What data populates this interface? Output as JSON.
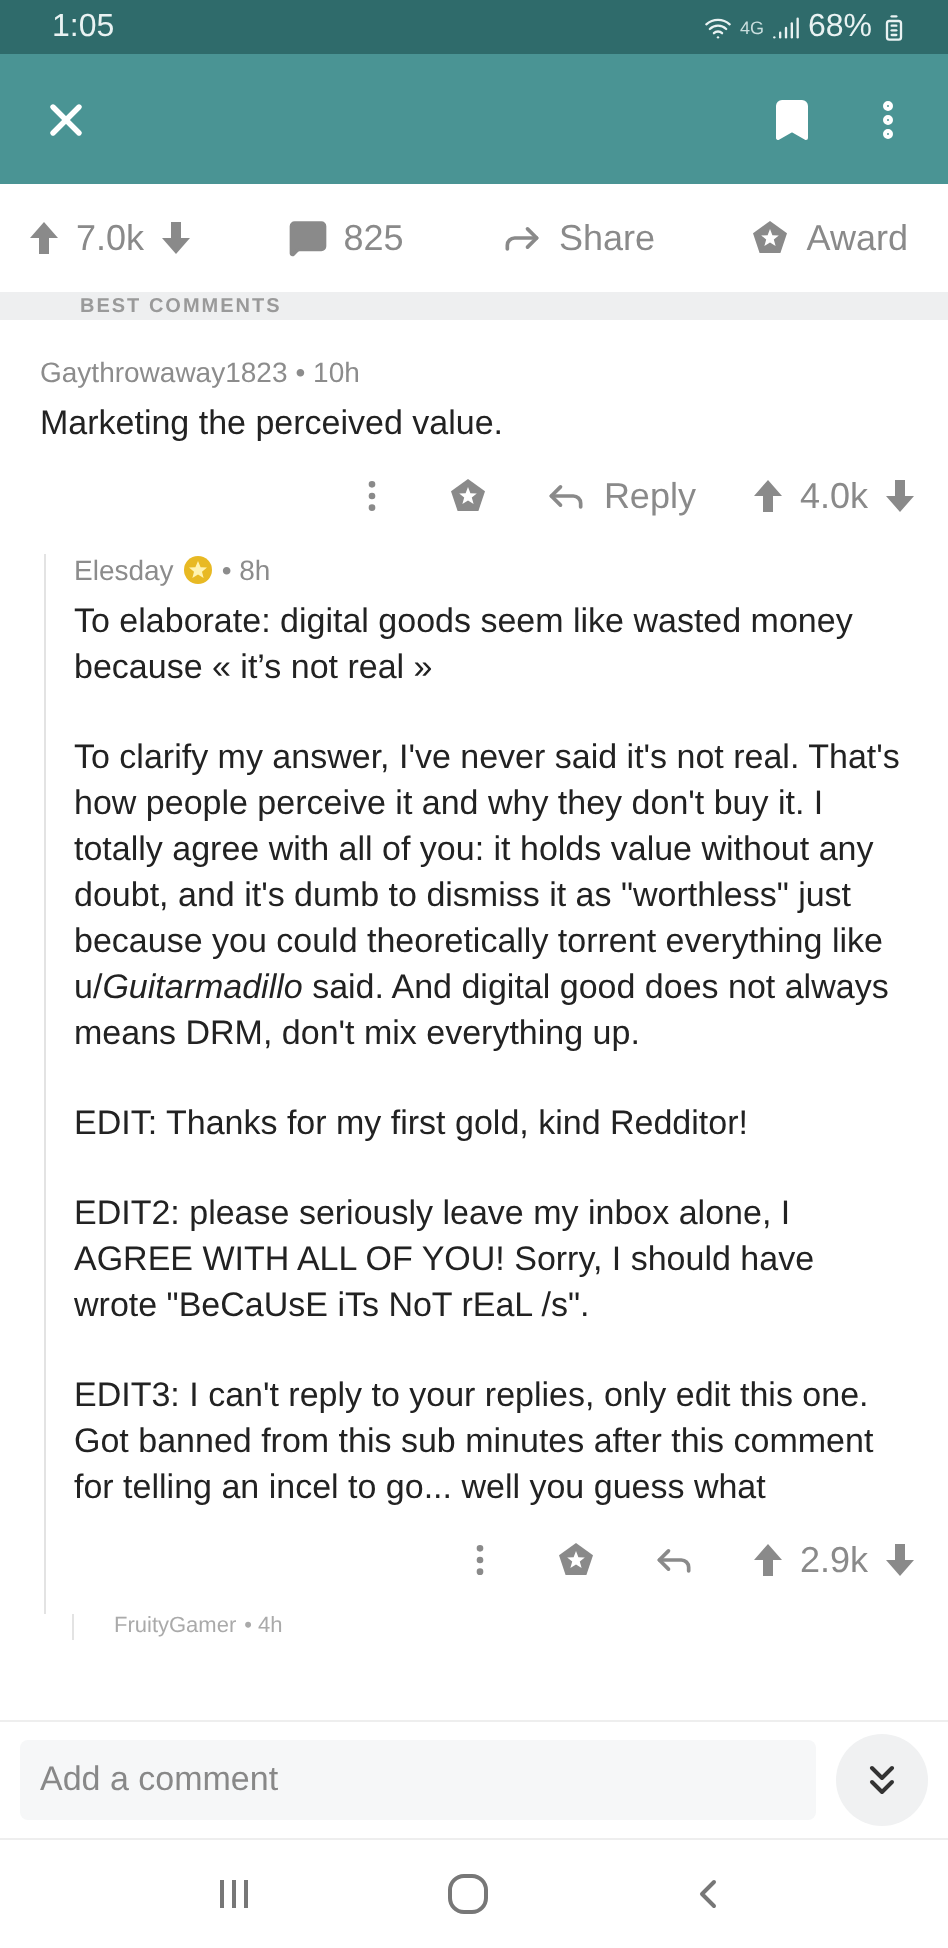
{
  "status_bar": {
    "time": "1:05",
    "network": "4G",
    "battery": "68%"
  },
  "post_actions": {
    "upvotes": "7.0k",
    "comments": "825",
    "share": "Share",
    "award": "Award"
  },
  "sort": {
    "label": "BEST COMMENTS"
  },
  "comments": [
    {
      "author": "Gaythrowaway1823",
      "time": "• 10h",
      "gilded": false,
      "reply_label": "Reply",
      "score": "4.0k",
      "paragraphs": [
        "Marketing the perceived value."
      ],
      "nested": false
    },
    {
      "author": "Elesday",
      "time": "• 8h",
      "gilded": true,
      "score": "2.9k",
      "nested": true,
      "paragraphs": [
        "To elaborate: digital goods seem like wasted money because « it’s not real »",
        "To clarify my answer, I've never said it's not real. That's how people perceive it and why they don't buy it. I totally agree with all of you: it holds value without any doubt, and it's dumb to dismiss it as \"worthless\" just because you could theoretically torrent everything like u/*Guitarmadillo* said. And digital good does not always means DRM, don't mix everything up.",
        "EDIT: Thanks for my first gold, kind Redditor!",
        "EDIT2: please seriously leave my inbox alone, I AGREE WITH ALL OF YOU! Sorry, I should have wrote \"BeCaUsE iTs NoT rEaL /s\".",
        "EDIT3: I can't reply to your replies, only edit this one. Got banned from this sub minutes after this comment for telling an incel to go... well you guess what"
      ]
    }
  ],
  "next_comment": {
    "author": "FruityGamer",
    "time": "• 4h"
  },
  "composer": {
    "placeholder": "Add a comment"
  }
}
